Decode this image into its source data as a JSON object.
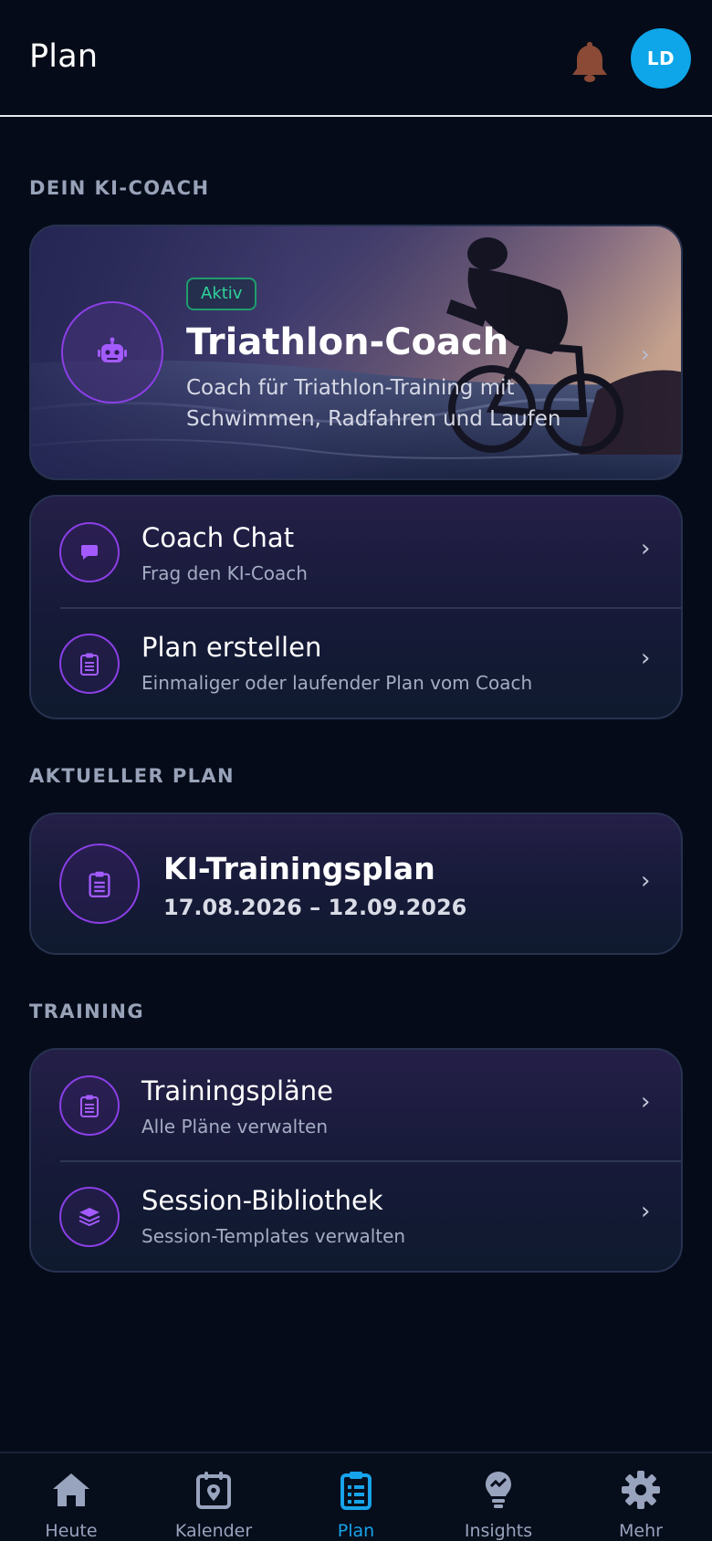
{
  "header": {
    "title": "Plan",
    "avatar_initials": "LD",
    "icons": {
      "notifications": "bell-icon"
    }
  },
  "coach_section": {
    "heading": "DEIN KI-COACH",
    "coach": {
      "badge": "Aktiv",
      "title": "Triathlon-Coach",
      "description": "Coach für Triathlon-Training mit Schwimmen, Radfahren und Laufen",
      "icon": "robot-icon"
    },
    "actions": [
      {
        "title": "Coach Chat",
        "subtitle": "Frag den KI-Coach",
        "icon": "chat-bubble-icon"
      },
      {
        "title": "Plan erstellen",
        "subtitle": "Einmaliger oder laufender Plan vom Coach",
        "icon": "clipboard-list-icon"
      }
    ]
  },
  "current_plan_section": {
    "heading": "AKTUELLER PLAN",
    "plan": {
      "title": "KI-Trainingsplan",
      "dates": "17.08.2026 – 12.09.2026",
      "icon": "clipboard-list-icon"
    }
  },
  "training_section": {
    "heading": "TRAINING",
    "items": [
      {
        "title": "Trainingspläne",
        "subtitle": "Alle Pläne verwalten",
        "icon": "clipboard-list-icon"
      },
      {
        "title": "Session-Bibliothek",
        "subtitle": "Session-Templates verwalten",
        "icon": "layers-icon"
      }
    ]
  },
  "bottom_nav": {
    "items": [
      {
        "label": "Heute",
        "icon": "home-icon",
        "active": false
      },
      {
        "label": "Kalender",
        "icon": "calendar-pin-icon",
        "active": false
      },
      {
        "label": "Plan",
        "icon": "clipboard-list-icon",
        "active": true
      },
      {
        "label": "Insights",
        "icon": "lightbulb-icon",
        "active": false
      },
      {
        "label": "Mehr",
        "icon": "gear-icon",
        "active": false
      }
    ]
  },
  "colors": {
    "background": "#050b18",
    "accent_purple": "#8b3fe6",
    "active_blue": "#17a3ea",
    "badge_green": "#2ed39a",
    "avatar_blue": "#0ea5e9"
  }
}
